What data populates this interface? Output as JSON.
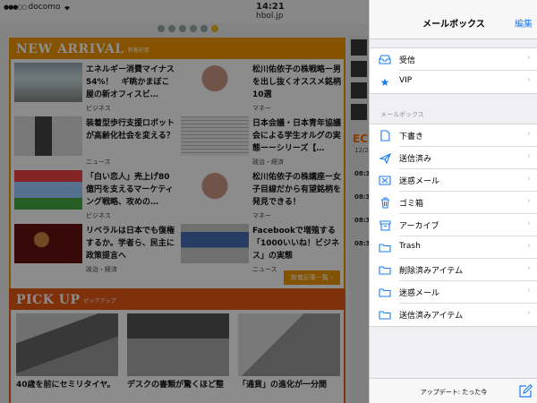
{
  "status_bar": {
    "carrier": "docomo",
    "time": "14:21",
    "url": "hbol.jp"
  },
  "website": {
    "new_arrival": {
      "title": "NEW ARRIVAL",
      "subtitle": "新着記事",
      "articles": [
        {
          "title": "エネルギー消費マイナス54%！　ギ眺かまぼこ屋の新オフィスビ…",
          "category": "ビジネス"
        },
        {
          "title": "松川佑依子の株戦略ー男を出し抜くオススメ銘柄10選",
          "category": "マネー"
        },
        {
          "title": "装着型歩行支援ロボットが高齢化社会を変える？",
          "category": "ニュース"
        },
        {
          "title": "日本会議・日本青年協議会による学生オルグの実態ーーシリーズ【…",
          "category": "政治・経済"
        },
        {
          "title": "「白い恋人」売上げ80億円を支えるマーケティング戦略、攻めの…",
          "category": "ビジネス"
        },
        {
          "title": "松川佑依子の株講座ー女子目線だから有望銘柄を発見できる！",
          "category": "マネー"
        },
        {
          "title": "リベラルは日本でも復権するか。学者ら、民主に政策提言へ",
          "category": "政治・経済"
        },
        {
          "title": "Facebookで増殖する「1000いいね！ビジネス」の実態",
          "category": "ニュース"
        }
      ],
      "more_label": "新着記事一覧"
    },
    "pick_up": {
      "title": "PICK UP",
      "subtitle": "ピックアップ",
      "articles": [
        {
          "title": "40歳を前にセミリタイヤ。"
        },
        {
          "title": "デスクの書類が驚くほど整"
        },
        {
          "title": "「通貨」の進化が一分間"
        }
      ]
    },
    "sidebar": {
      "heading": "EC",
      "date": "12/2",
      "times": [
        "08:3",
        "08:3",
        "08:3",
        "08:3"
      ]
    }
  },
  "mail_panel": {
    "title": "メールボックス",
    "edit_label": "編集",
    "top_items": [
      {
        "label": "受信",
        "icon": "inbox-tray-icon"
      },
      {
        "label": "VIP",
        "icon": "star-icon"
      }
    ],
    "section_label": "メールボックス",
    "mailbox_items": [
      {
        "label": "下書き",
        "icon": "draft-document-icon"
      },
      {
        "label": "送信済み",
        "icon": "paper-plane-icon"
      },
      {
        "label": "迷惑メール",
        "icon": "junk-tray-icon"
      },
      {
        "label": "ゴミ箱",
        "icon": "trash-can-icon"
      },
      {
        "label": "アーカイブ",
        "icon": "archive-box-icon"
      },
      {
        "label": "Trash",
        "icon": "folder-icon"
      },
      {
        "label": "削除済みアイテム",
        "icon": "folder-icon"
      },
      {
        "label": "迷惑メール",
        "icon": "folder-icon"
      },
      {
        "label": "送信済みアイテム",
        "icon": "folder-icon"
      }
    ],
    "footer_status": "アップデート: たった今",
    "compose_icon": "compose-icon",
    "accent_color": "#1a7cf5"
  }
}
